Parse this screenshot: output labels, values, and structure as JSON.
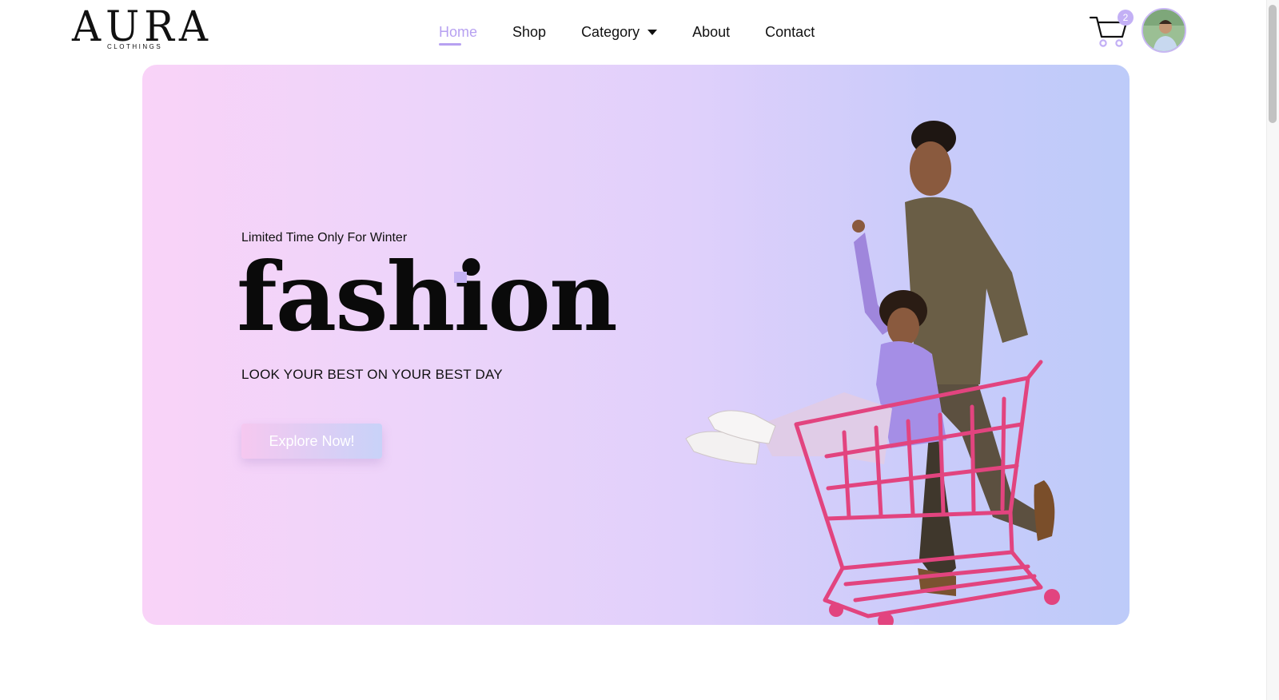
{
  "brand": {
    "wordmark": "AURA",
    "subtitle": "CLOTHINGS"
  },
  "nav": {
    "items": [
      {
        "label": "Home",
        "active": true
      },
      {
        "label": "Shop",
        "active": false
      },
      {
        "label": "Category",
        "active": false,
        "has_dropdown": true
      },
      {
        "label": "About",
        "active": false
      },
      {
        "label": "Contact",
        "active": false
      }
    ]
  },
  "cart": {
    "icon": "cart-icon",
    "count": "2"
  },
  "user": {
    "avatar_icon": "user-avatar"
  },
  "hero": {
    "eyebrow": "Limited Time Only For Winter",
    "headline": "fashion",
    "tagline": "LOOK YOUR BEST ON YOUR BEST DAY",
    "cta_label": "Explore Now!",
    "image": "couple-with-pink-shopping-cart"
  },
  "colors": {
    "accent": "#b7a1f1",
    "badge": "#c3b0f5",
    "cart_pink": "#e2447f",
    "gradient_start": "#f9d3f8",
    "gradient_end": "#bdcbf9"
  }
}
